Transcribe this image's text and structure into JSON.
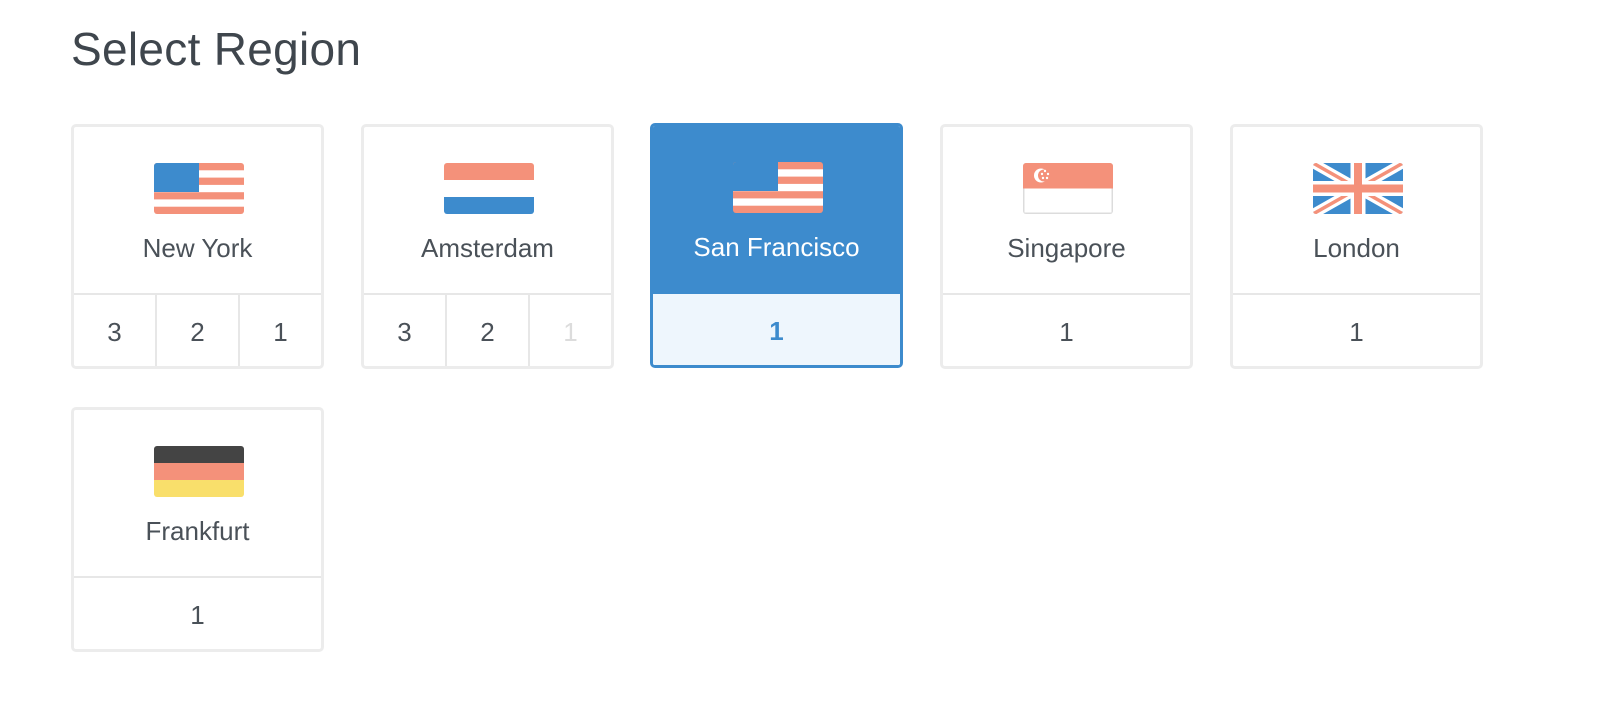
{
  "title": "Select Region",
  "colors": {
    "selected": "#3d8bcd",
    "selected_bg": "#eef6fd",
    "flag_red": "#f4917a",
    "flag_blue": "#3d8bcd"
  },
  "regions": [
    {
      "name": "New York",
      "flag": "us-flag-icon",
      "options": [
        "3",
        "2",
        "1"
      ],
      "disabled": [],
      "selected": false
    },
    {
      "name": "Amsterdam",
      "flag": "nl-flag-icon",
      "options": [
        "3",
        "2",
        "1"
      ],
      "disabled": [
        "1"
      ],
      "selected": false
    },
    {
      "name": "San Francisco",
      "flag": "us-flag-icon",
      "options": [
        "1"
      ],
      "disabled": [],
      "selected": true,
      "selected_option": "1"
    },
    {
      "name": "Singapore",
      "flag": "sg-flag-icon",
      "options": [
        "1"
      ],
      "disabled": [],
      "selected": false
    },
    {
      "name": "London",
      "flag": "uk-flag-icon",
      "options": [
        "1"
      ],
      "disabled": [],
      "selected": false
    },
    {
      "name": "Frankfurt",
      "flag": "de-flag-icon",
      "options": [
        "1"
      ],
      "disabled": [],
      "selected": false
    }
  ]
}
